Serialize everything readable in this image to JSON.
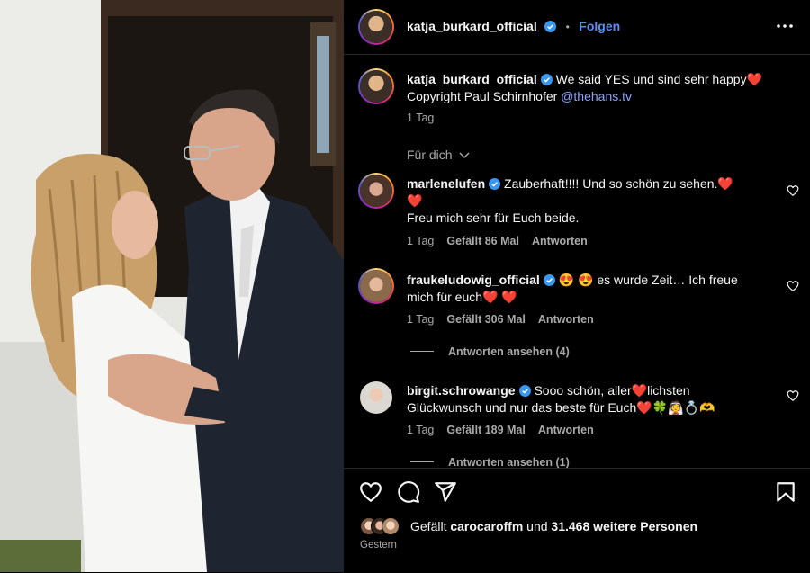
{
  "post": {
    "author": "katja_burkard_official",
    "follow_label": "Folgen",
    "dot": "•",
    "caption_text": "We said YES und sind sehr happy❤️",
    "caption_line2_prefix": "Copyright Paul Schirnhofer ",
    "caption_link": "@thehans.tv",
    "caption_time": "1 Tag",
    "filter_label": "Für dich",
    "likes_prefix": "Gefällt ",
    "likes_user": "carocaroffm",
    "likes_mid": " und ",
    "likes_count": "31.468 weitere Personen",
    "date": "Gestern"
  },
  "comments": [
    {
      "user": "marlenelufen",
      "text_line1": "Zauberhaft!!!! Und so schön zu sehen.❤️",
      "text_line2": "❤️",
      "text_line3": "Freu mich sehr für Euch beide.",
      "time": "1 Tag",
      "likes": "Gefällt 86 Mal",
      "reply": "Antworten"
    },
    {
      "user": "fraukeludowig_official",
      "text_line1": "😍 😍  es wurde Zeit… Ich freue",
      "text_line2": "mich für euch❤️ ❤️",
      "time": "1 Tag",
      "likes": "Gefällt 306 Mal",
      "reply": "Antworten",
      "view_replies": "Antworten ansehen (4)"
    },
    {
      "user": "birgit.schrowange",
      "text_line1": "Sooo schön, aller❤️lichsten",
      "text_line2": "Glückwunsch und nur das beste für Euch❤️🍀👰💍🫶",
      "time": "1 Tag",
      "likes": "Gefällt 189 Mal",
      "reply": "Antworten",
      "view_replies": "Antworten ansehen (1)"
    }
  ],
  "icons": {
    "verified": "verified-badge-icon",
    "more": "more-options-icon",
    "like": "heart-icon",
    "comment": "comment-icon",
    "share": "share-icon",
    "save": "bookmark-icon"
  },
  "colors": {
    "background": "#000000",
    "accent": "#5b8cff",
    "verified": "#3897f0",
    "muted": "#a8a8a8"
  }
}
